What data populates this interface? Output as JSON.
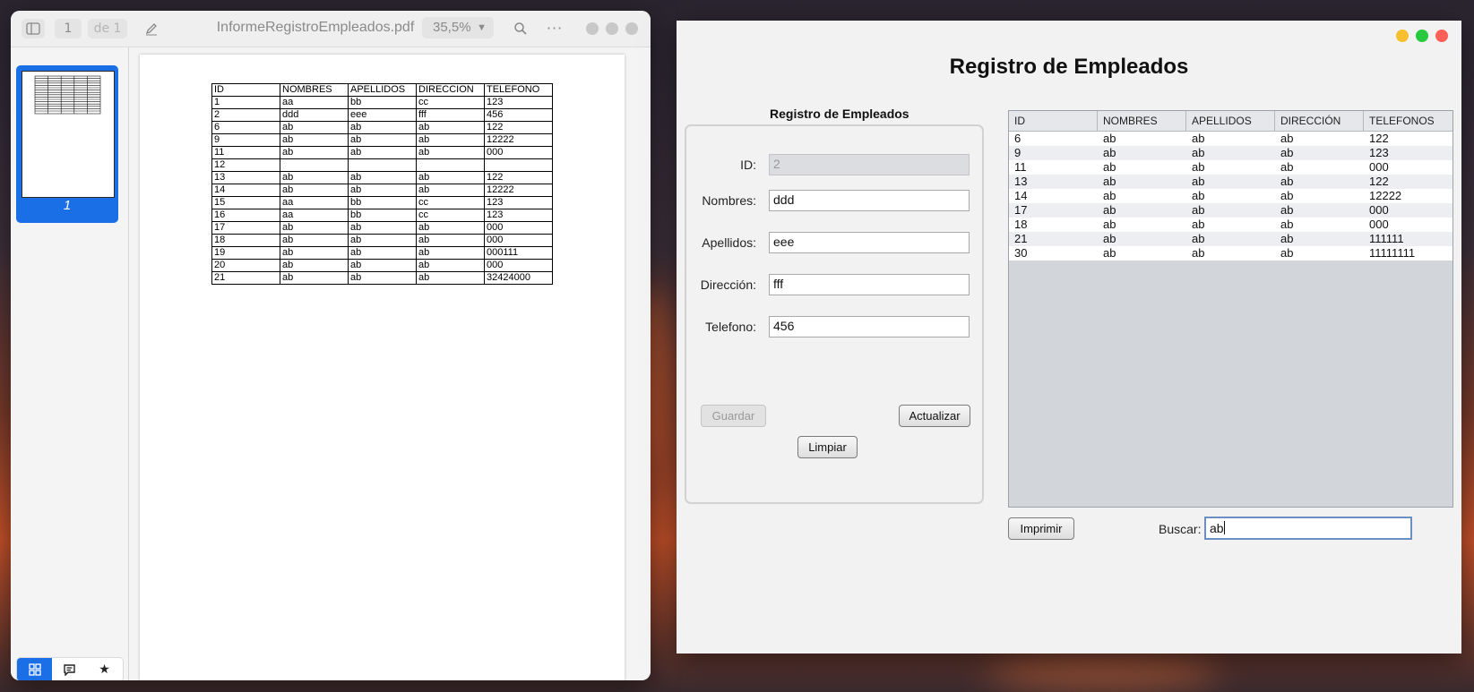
{
  "pdf_viewer": {
    "page_input": "1",
    "page_total": "de 1",
    "filename": "InformeRegistroEmpleados.pdf",
    "zoom": "35,5%",
    "thumbnail_label": "1",
    "table": [
      [
        "ID",
        "NOMBRES",
        "APELLIDOS",
        "DIRECCION",
        "TELEFONO"
      ],
      [
        "1",
        "aa",
        "bb",
        "cc",
        "123"
      ],
      [
        "2",
        "ddd",
        "eee",
        "fff",
        "456"
      ],
      [
        "6",
        "ab",
        "ab",
        "ab",
        "122"
      ],
      [
        "9",
        "ab",
        "ab",
        "ab",
        "12222"
      ],
      [
        "11",
        "ab",
        "ab",
        "ab",
        "000"
      ],
      [
        "12",
        "",
        "",
        "",
        ""
      ],
      [
        "13",
        "ab",
        "ab",
        "ab",
        "122"
      ],
      [
        "14",
        "ab",
        "ab",
        "ab",
        "12222"
      ],
      [
        "15",
        "aa",
        "bb",
        "cc",
        "123"
      ],
      [
        "16",
        "aa",
        "bb",
        "cc",
        "123"
      ],
      [
        "17",
        "ab",
        "ab",
        "ab",
        "000"
      ],
      [
        "18",
        "ab",
        "ab",
        "ab",
        "000"
      ],
      [
        "19",
        "ab",
        "ab",
        "ab",
        "000111"
      ],
      [
        "20",
        "ab",
        "ab",
        "ab",
        "000"
      ],
      [
        "21",
        "ab",
        "ab",
        "ab",
        "32424000"
      ]
    ]
  },
  "app": {
    "title": "Registro de Empleados",
    "form_title": "Registro de Empleados",
    "fields": {
      "id": {
        "label": "ID:",
        "value": "2"
      },
      "nombres": {
        "label": "Nombres:",
        "value": "ddd"
      },
      "apellidos": {
        "label": "Apellidos:",
        "value": "eee"
      },
      "direccion": {
        "label": "Dirección:",
        "value": "fff"
      },
      "telefono": {
        "label": "Telefono:",
        "value": "456"
      }
    },
    "buttons": {
      "guardar": "Guardar",
      "actualizar": "Actualizar",
      "limpiar": "Limpiar",
      "imprimir": "Imprimir"
    },
    "table_headers": [
      "ID",
      "NOMBRES",
      "APELLIDOS",
      "DIRECCIÓN",
      "TELEFONOS"
    ],
    "table_rows": [
      [
        "6",
        "ab",
        "ab",
        "ab",
        "122"
      ],
      [
        "9",
        "ab",
        "ab",
        "ab",
        "123"
      ],
      [
        "11",
        "ab",
        "ab",
        "ab",
        "000"
      ],
      [
        "13",
        "ab",
        "ab",
        "ab",
        "122"
      ],
      [
        "14",
        "ab",
        "ab",
        "ab",
        "12222"
      ],
      [
        "17",
        "ab",
        "ab",
        "ab",
        "000"
      ],
      [
        "18",
        "ab",
        "ab",
        "ab",
        "000"
      ],
      [
        "21",
        "ab",
        "ab",
        "ab",
        "111111"
      ],
      [
        "30",
        "ab",
        "ab",
        "ab",
        "11111111"
      ]
    ],
    "search": {
      "label": "Buscar:",
      "value": "ab"
    }
  },
  "colors": {
    "accent": "#1a6fe6",
    "traffic_yellow": "#f5bf2d",
    "traffic_green": "#27c93f",
    "traffic_red": "#ff5f57"
  },
  "icons": [
    "sidebar-toggle-icon",
    "annotate-pen-icon",
    "search-icon",
    "more-icon",
    "grid-view-icon",
    "comment-icon",
    "star-icon"
  ]
}
